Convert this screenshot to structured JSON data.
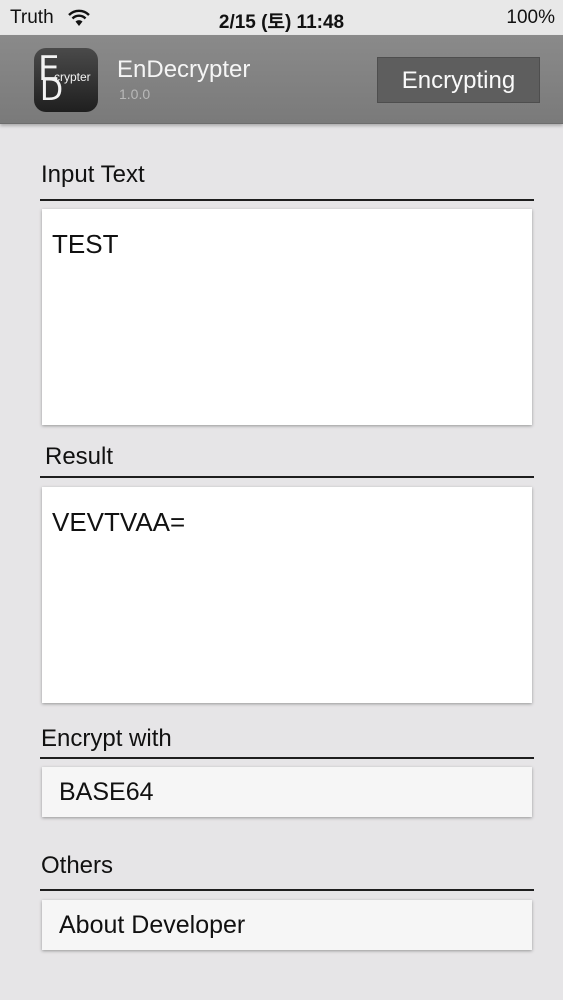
{
  "status_bar": {
    "carrier": "Truth",
    "time": "2/15 (토) 11:48",
    "battery": "100%"
  },
  "header": {
    "logo_letters": [
      "E",
      "D"
    ],
    "logo_text": "crypter",
    "title": "EnDecrypter",
    "version": "1.0.0",
    "mode_button": "Encrypting"
  },
  "input_section": {
    "label": "Input Text",
    "value": "TEST"
  },
  "result_section": {
    "label": "Result",
    "value": "VEVTVAA="
  },
  "encrypt_section": {
    "label": "Encrypt with",
    "selected": "BASE64"
  },
  "others_section": {
    "label": "Others",
    "about_button": "About Developer"
  }
}
